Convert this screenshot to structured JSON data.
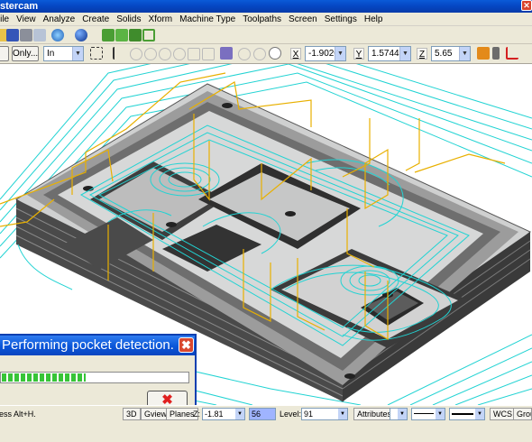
{
  "window": {
    "title": "stercam"
  },
  "menu": [
    "File",
    "View",
    "Analyze",
    "Create",
    "Solids",
    "Xform",
    "Machine Type",
    "Toolpaths",
    "Screen",
    "Settings",
    "Help"
  ],
  "toolbar2": {
    "only_label": "Only...",
    "in_value": "In",
    "x_label": "X",
    "x_value": "-1.90201",
    "y_label": "Y",
    "y_value": "1.57447",
    "z_label": "Z",
    "z_value": "5.65"
  },
  "dialog": {
    "title": "Performing pocket detection.",
    "progress": 0.45,
    "cancel_glyph": "✖",
    "close_glyph": "✖"
  },
  "status": {
    "hint": "ress Alt+H.",
    "btn_3d": "3D",
    "btn_gview": "Gview",
    "btn_planes": "Planes",
    "z_label": "Z:",
    "z_value": "-1.81",
    "color_value": "56",
    "level_label": "Level:",
    "level_value": "91",
    "btn_attributes": "Attributes",
    "btn_wcs": "WCS",
    "btn_groups": "Grou"
  },
  "colors": {
    "toolpath_cyan": "#22d3d3",
    "toolpath_yellow": "#e8b000",
    "part_dark": "#3a3a3a"
  }
}
